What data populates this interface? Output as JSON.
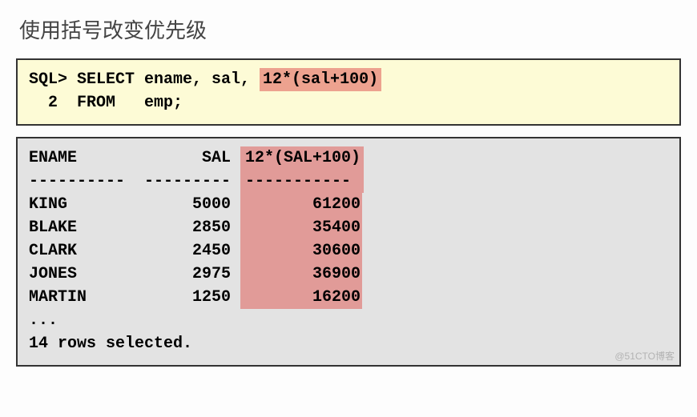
{
  "title": "使用括号改变优先级",
  "sql": {
    "line1_prefix": "SQL> SELECT ename, sal, ",
    "line1_highlight": "12*(sal+100)",
    "line2": "  2  FROM   emp;"
  },
  "result": {
    "headers": {
      "ename": "ENAME",
      "sal": "SAL",
      "calc": "12*(SAL+100)"
    },
    "dashes": {
      "ename": "----------",
      "sal": "---------",
      "calc": "-----------"
    },
    "rows": [
      {
        "ename": "KING",
        "sal": "5000",
        "calc": "61200"
      },
      {
        "ename": "BLAKE",
        "sal": "2850",
        "calc": "35400"
      },
      {
        "ename": "CLARK",
        "sal": "2450",
        "calc": "30600"
      },
      {
        "ename": "JONES",
        "sal": "2975",
        "calc": "36900"
      },
      {
        "ename": "MARTIN",
        "sal": "1250",
        "calc": "16200"
      }
    ],
    "ellipsis": "...",
    "footer": "14 rows selected."
  },
  "watermark": "@51CTO博客"
}
